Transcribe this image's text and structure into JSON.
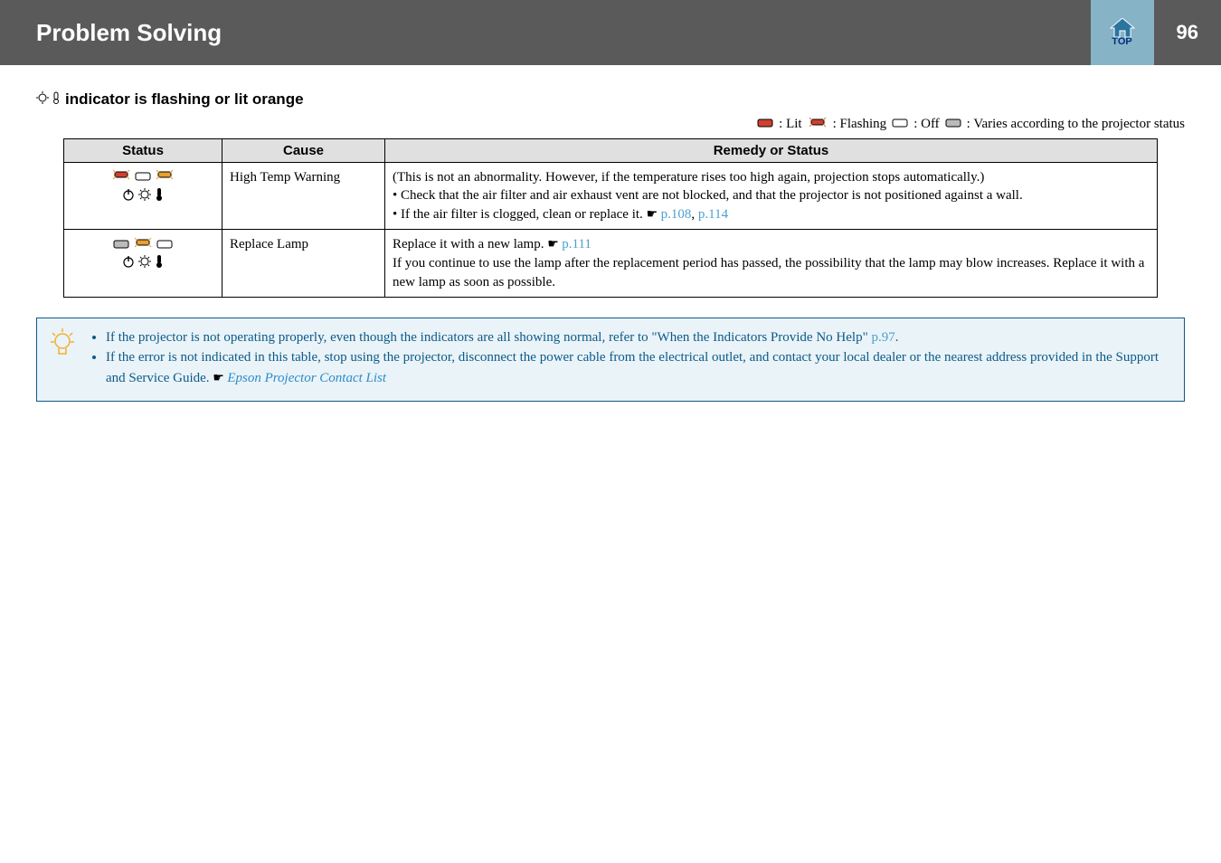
{
  "header": {
    "title": "Problem Solving",
    "top_label": "TOP",
    "page_number": "96"
  },
  "section": {
    "heading": "indicator is flashing or lit orange"
  },
  "legend": {
    "lit_label": ": Lit",
    "flashing_label": ": Flashing",
    "off_label": ": Off",
    "varies_label": ": Varies according to the projector status"
  },
  "table": {
    "head": {
      "c1": "Status",
      "c2": "Cause",
      "c3": "Remedy or Status"
    },
    "rows": [
      {
        "cause": "High Temp Warning",
        "remedy_line1": "(This is not an abnormality. However, if the temperature rises too high again, projection stops automatically.)",
        "remedy_b1": "Check that the air filter and air exhaust vent are not blocked, and that the projector is not positioned against a wall.",
        "remedy_b2_pre": "If the air filter is clogged, clean or replace it. ",
        "remedy_b2_link1": "p.108",
        "remedy_b2_sep": ", ",
        "remedy_b2_link2": "p.114"
      },
      {
        "cause": "Replace Lamp",
        "remedy_line1_pre": "Replace it with a new lamp. ",
        "remedy_line1_link": "p.111",
        "remedy_p2": "If you continue to use the lamp after the replacement period has passed, the possibility that the lamp may blow increases. Replace it with a new lamp as soon as possible."
      }
    ]
  },
  "note": {
    "b1_pre": "If the projector is not operating properly, even though the indicators are all showing normal, refer to \"When the Indicators Provide No Help\" ",
    "b1_link": "p.97",
    "b1_post": ".",
    "b2_pre": "If the error is not indicated in this table, stop using the projector, disconnect the power cable from the electrical outlet, and contact your local dealer or the nearest address provided in the Support and Service Guide. ",
    "b2_link": "Epson Projector Contact List"
  }
}
